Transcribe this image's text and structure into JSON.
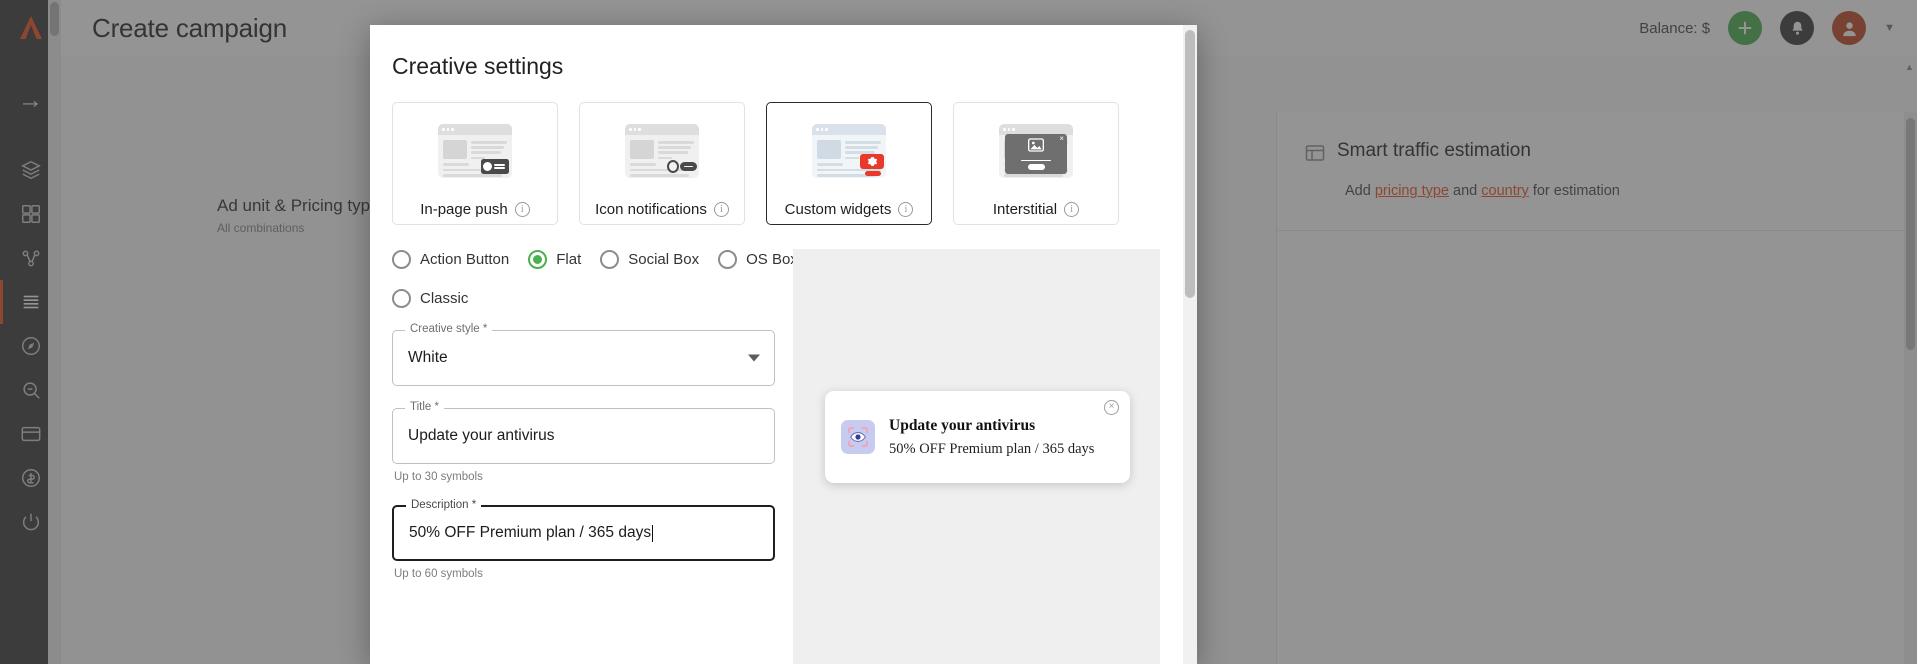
{
  "app": {
    "logo_icon": "logo-a-icon",
    "header": {
      "title": "Create campaign",
      "balance_label": "Balance: $",
      "add_icon": "plus-icon",
      "notifications_icon": "bell-icon",
      "avatar_icon": "user-avatar-icon",
      "menu_caret_icon": "chevron-down-icon"
    },
    "sidebar": {
      "collapse_icon": "arrow-right-icon",
      "items": [
        {
          "icon": "box-icon",
          "name": "sidebar-item-campaigns"
        },
        {
          "icon": "grid-icon",
          "name": "sidebar-item-dashboard"
        },
        {
          "icon": "chart-icon",
          "name": "sidebar-item-statistics"
        },
        {
          "icon": "list-icon",
          "name": "sidebar-item-list",
          "active": true
        },
        {
          "icon": "compass-icon",
          "name": "sidebar-item-explore"
        },
        {
          "icon": "search-doc-icon",
          "name": "sidebar-item-research"
        },
        {
          "icon": "card-icon",
          "name": "sidebar-item-billing"
        },
        {
          "icon": "coin-icon",
          "name": "sidebar-item-finance"
        },
        {
          "icon": "power-icon",
          "name": "sidebar-item-power"
        }
      ]
    }
  },
  "background_page": {
    "ad_unit_title": "Ad unit & Pricing type",
    "ad_unit_sub": "All combinations"
  },
  "right_panel": {
    "icon": "estimation-icon",
    "title": "Smart traffic estimation",
    "text_before": "Add ",
    "link_1": "pricing type",
    "text_mid": " and ",
    "link_2": "country",
    "text_after": " for estimation"
  },
  "modal": {
    "title": "Creative settings",
    "creative_types": [
      {
        "label": "In-page push",
        "art": "inpage-push",
        "info_icon": "info-icon",
        "selected": false
      },
      {
        "label": "Icon notifications",
        "art": "icon-notification",
        "info_icon": "info-icon",
        "selected": false
      },
      {
        "label": "Custom widgets",
        "art": "custom-widget",
        "info_icon": "info-icon",
        "selected": true
      },
      {
        "label": "Interstitial",
        "art": "interstitial",
        "info_icon": "info-icon",
        "selected": false
      }
    ],
    "style_radios_row1": [
      {
        "label": "Action Button",
        "selected": false
      },
      {
        "label": "Flat",
        "selected": true
      },
      {
        "label": "Social Box",
        "selected": false
      },
      {
        "label": "OS Box",
        "selected": false
      }
    ],
    "style_radios_row2": [
      {
        "label": "Classic",
        "selected": false
      }
    ],
    "fields": {
      "creative_style": {
        "label": "Creative style *",
        "value": "White",
        "caret_icon": "chevron-down-icon"
      },
      "title": {
        "label": "Title *",
        "value": "Update your antivirus",
        "helper": "Up to 30 symbols"
      },
      "description": {
        "label": "Description *",
        "value": "50% OFF Premium plan / 365 days",
        "helper": "Up to 60 symbols",
        "focused": true
      }
    },
    "preview": {
      "icon": "eye-scan-icon",
      "title": "Update your antivirus",
      "description": "50% OFF Premium plan / 365 days",
      "close_icon": "close-circle-icon"
    }
  },
  "colors": {
    "brand_orange": "#f05423",
    "sidebar_dark": "#3c3c3c",
    "radio_green": "#4caf50",
    "widget_red": "#e8392a",
    "selected_border": "#2b2b2b"
  }
}
